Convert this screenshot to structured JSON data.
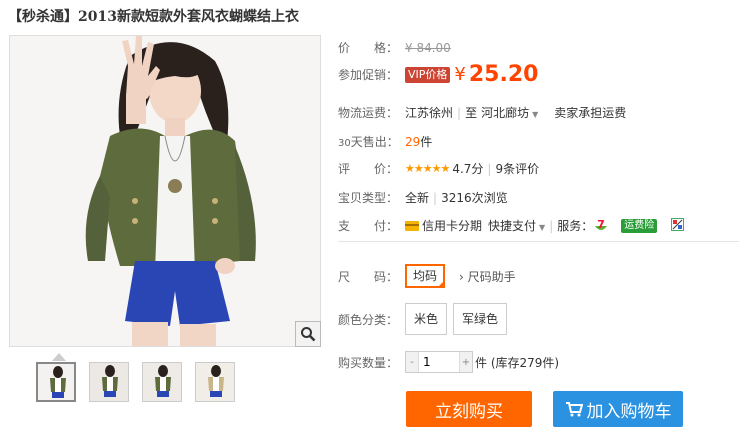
{
  "title": "【秒杀通】2013新款短款外套风衣蝴蝶结上衣",
  "price": {
    "label": "价　　格：",
    "original": "¥ 84.00"
  },
  "promo": {
    "label": "参加促销：",
    "badge": "VIP价格",
    "currency": "¥",
    "value": "25.20"
  },
  "shipping": {
    "label": "物流运费：",
    "from": "江苏徐州",
    "sep": "|",
    "to_label": "至",
    "to": "河北廊坊",
    "fee": "卖家承担运费"
  },
  "sales": {
    "label_prefix": "30",
    "label": "天售出：",
    "count": "29",
    "unit": "件"
  },
  "rating": {
    "label": "评　　价：",
    "stars": "★★★★★",
    "score": "4.7分",
    "reviews": "9条评价"
  },
  "condition": {
    "label": "宝贝类型：",
    "value": "全新",
    "views": "3216次浏览"
  },
  "payment": {
    "label": "支　　付：",
    "credit": "信用卡分期",
    "quick": "快捷支付",
    "service_label": "服务：",
    "insurance": "运费险"
  },
  "size": {
    "label": "尺　　码：",
    "selected": "均码",
    "helper": "尺码助手"
  },
  "color": {
    "label": "颜色分类：",
    "options": [
      "米色",
      "军绿色"
    ]
  },
  "quantity": {
    "label": "购买数量：",
    "value": "1",
    "minus": "-",
    "plus": "+",
    "stock": "件 (库存279件)"
  },
  "actions": {
    "buy": "立刻购买",
    "cart": "加入购物车"
  },
  "colors": {
    "accent": "#ff6600",
    "price": "#ff4400",
    "cart": "#2a92e0"
  }
}
